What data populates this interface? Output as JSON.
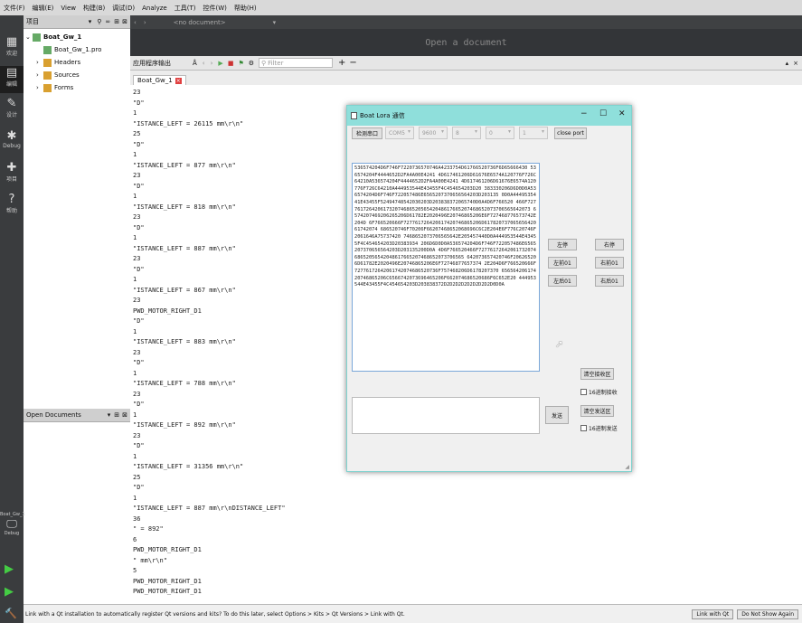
{
  "menu": [
    "文件(F)",
    "编辑(E)",
    "View",
    "构建(B)",
    "调试(D)",
    "Analyze",
    "工具(T)",
    "控件(W)",
    "帮助(H)"
  ],
  "modes": [
    {
      "label": "欢迎",
      "icon": "grid-icon"
    },
    {
      "label": "编辑",
      "icon": "edit-icon"
    },
    {
      "label": "设计",
      "icon": "pen-icon"
    },
    {
      "label": "Debug",
      "icon": "bug-icon"
    },
    {
      "label": "项目",
      "icon": "wrench-icon"
    },
    {
      "label": "帮助",
      "icon": "help-icon"
    }
  ],
  "kit": {
    "label": "Boat_Gw_1",
    "sub": "Debug"
  },
  "project_pane": {
    "selector": "项目",
    "tree": [
      {
        "label": "Boat_Gw_1",
        "level": 0,
        "bold": true
      },
      {
        "label": "Boat_Gw_1.pro",
        "level": 1
      },
      {
        "label": "Headers",
        "level": 1
      },
      {
        "label": "Sources",
        "level": 1
      },
      {
        "label": "Forms",
        "level": 1
      }
    ]
  },
  "open_documents": {
    "title": "Open Documents"
  },
  "editor": {
    "doc_combo": "<no document>",
    "placeholder": "Open a document"
  },
  "output_pane": {
    "title": "应用程序输出",
    "filter_placeholder": "Filter",
    "tab": "Boat_Gw_1",
    "lines": [
      "23",
      "\"D\"",
      "1",
      "\"ISTANCE_LEFT = 26115 mm\\r\\n\"",
      "25",
      "\"D\"",
      "1",
      "\"ISTANCE_LEFT = 877 mm\\r\\n\"",
      "23",
      "\"D\"",
      "1",
      "\"ISTANCE_LEFT = 818 mm\\r\\n\"",
      "23",
      "\"D\"",
      "1",
      "\"ISTANCE_LEFT = 887 mm\\r\\n\"",
      "23",
      "\"D\"",
      "1",
      "\"ISTANCE_LEFT = 867 mm\\r\\n\"",
      "23",
      "PWD_MOTOR_RIGHT_D1",
      "\"D\"",
      "1",
      "\"ISTANCE_LEFT = 883 mm\\r\\n\"",
      "23",
      "\"D\"",
      "1",
      "\"ISTANCE_LEFT = 788 mm\\r\\n\"",
      "23",
      "\"D\"",
      "1",
      "\"ISTANCE_LEFT = 892 mm\\r\\n\"",
      "23",
      "\"D\"",
      "1",
      "\"ISTANCE_LEFT = 31356 mm\\r\\n\"",
      "25",
      "\"D\"",
      "1",
      "\"ISTANCE_LEFT = 887 mm\\r\\nDISTANCE_LEFT\"",
      "36",
      "\" = 892\"",
      "6",
      "PWD_MOTOR_RIGHT_D1",
      "\" mm\\r\\n\"",
      "5",
      "PWD_MOTOR_RIGHT_D1",
      "PWD_MOTOR_RIGHT_D1"
    ]
  },
  "status": {
    "message": "Link with a Qt installation to automatically register Qt versions and kits? To do this later, select Options > Kits > Qt Versions > Link with Qt.",
    "link_button": "Link with Qt",
    "dismiss_button": "Do Not Show Again"
  },
  "dialog": {
    "title": "Boat Lora 通信",
    "detect_button": "检测串口",
    "port": "COM5",
    "baud": "9600",
    "databits": "8",
    "parity": "0",
    "stopbits": "1",
    "close_button": "close port",
    "received_hex": "536574204D6F746F7220736570746A4233754D61766520736F6D65666430 536574204F4444652D2FA4A00E4241 4D617461206D61676E6574A120776F726C64210A536574204F4444652D2FA4A00E4241 4D617461206D61676E6574A120776F726C64210A444953544E43455F4C454654203D20 383330206D6D0D0A536574204D6F746F722057486E6565207370656564203D203135 0D0A4449535441E43455F52494748542030203D203838372065740D0A4D6F766520 466F7277617264206173207468652056542048617665207468652073706565642073 6574207469206265206D61782E2020496E20746865206E6F727468776573742E204D 6F766520666F727761726420617420746865206D61782073706565642061742074 686520746F70206F66207468652068696C6C2E204E6F776C20746F2061646A75737420 7468652073706565642E205457440D0A444953544E43455F4C454654203D20383934 206D6D0D0A536574204D6F746F722057486E6565207370656564203D203135200D0A 4D6F766520466F7277617264206173207468652056542048617665207468652073706565 642073657420746F206265206D61782E2020496E20746865206E6F72746877657374 2E204D6F766520666F72776172642061742074686520736F757468206D6178207370 65656420617420746865206C6566742073696465206F662074686520686F6C652E20 444953544E43455F4C454654203D203838372D2D2D2D2D2D2D2D2D0D0A",
    "direction_buttons": {
      "left_stop": "左停",
      "right_stop": "右停",
      "left_forward": "左前01",
      "right_forward": "右前01",
      "left_back": "左后01",
      "right_back": "右后01"
    },
    "clear_recv": "清空接收区",
    "hex_recv": "16进制接收",
    "send_button": "发送",
    "clear_send": "清空发送区",
    "hex_send": "16进制发送"
  }
}
